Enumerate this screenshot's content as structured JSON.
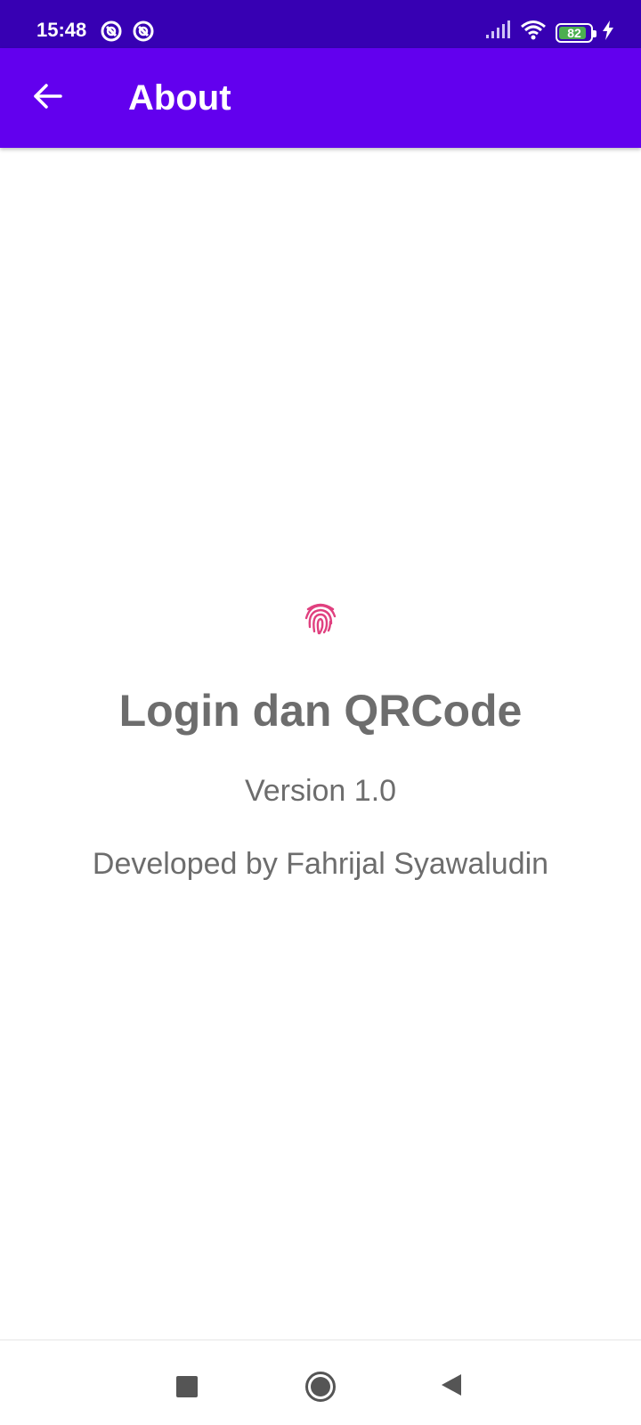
{
  "status_bar": {
    "time": "15:48",
    "left_icons": [
      "notification-icon",
      "notification-icon"
    ],
    "right_icons": [
      "signal-icon",
      "wifi-icon",
      "battery-icon",
      "charging-icon"
    ],
    "battery_level": "82",
    "battery_fraction": 0.82,
    "background_color": "#3700b3"
  },
  "app_bar": {
    "title": "About",
    "back_icon": "arrow-back-icon",
    "background_color": "#6200ee"
  },
  "about": {
    "icon": "fingerprint-icon",
    "icon_color": "#e0407f",
    "app_name": "Login dan QRCode",
    "version": "Version 1.0",
    "developer": "Developed by Fahrijal Syawaludin",
    "text_color": "#6d6d6d"
  },
  "nav_bar": {
    "buttons": [
      "recents-button",
      "home-button",
      "back-button"
    ]
  }
}
